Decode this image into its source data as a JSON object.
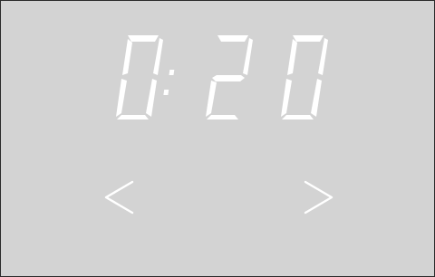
{
  "display": {
    "time": "0:20",
    "digit_color": "#ffffff",
    "background_color": "#d3d3d3"
  },
  "controls": {
    "previous_icon": "chevron-left-icon",
    "next_icon": "chevron-right-icon"
  }
}
